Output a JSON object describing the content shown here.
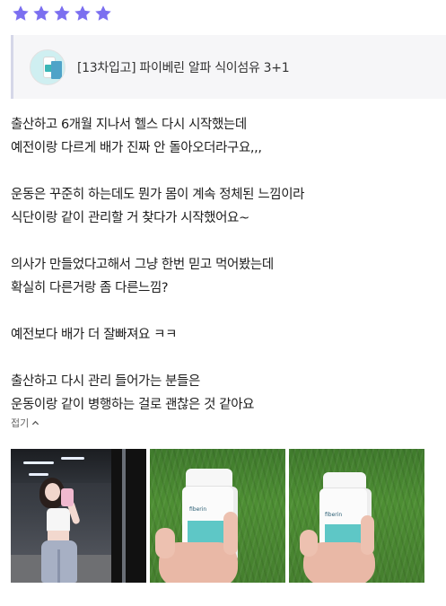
{
  "rating": {
    "value": 5,
    "max": 5,
    "color": "#7b6ff0"
  },
  "product": {
    "title": "[13차입고] 파이베린 알파 식이섬유 3+1",
    "thumbnail_icon": "product-thumbnail"
  },
  "review": {
    "paragraphs": [
      {
        "lines": [
          "출산하고 6개월 지나서 헬스 다시 시작했는데",
          "예전이랑 다르게 배가 진짜 안 돌아오더라구요,,,"
        ]
      },
      {
        "lines": [
          "운동은 꾸준히 하는데도 뭔가 몸이 계속 정체된 느낌이라",
          "식단이랑 같이 관리할 거 찾다가 시작했어요~"
        ]
      },
      {
        "lines": [
          "의사가 만들었다고해서 그냥 한번 믿고 먹어봤는데",
          "확실히 다른거랑 좀 다른느낌?"
        ]
      },
      {
        "lines": [
          "예전보다 배가 더 잘빠져요 ㅋㅋ"
        ]
      },
      {
        "lines": [
          "출산하고 다시 관리 들어가는 분들은",
          "운동이랑 같이 병행하는 걸로 괜찮은 것 같아요"
        ]
      }
    ],
    "fold_label": "접기",
    "fold_icon": "chevron-up-icon"
  },
  "photos": [
    {
      "name": "gym-selfie-photo"
    },
    {
      "name": "supplement-bottle-photo-1"
    },
    {
      "name": "supplement-bottle-photo-2"
    }
  ]
}
